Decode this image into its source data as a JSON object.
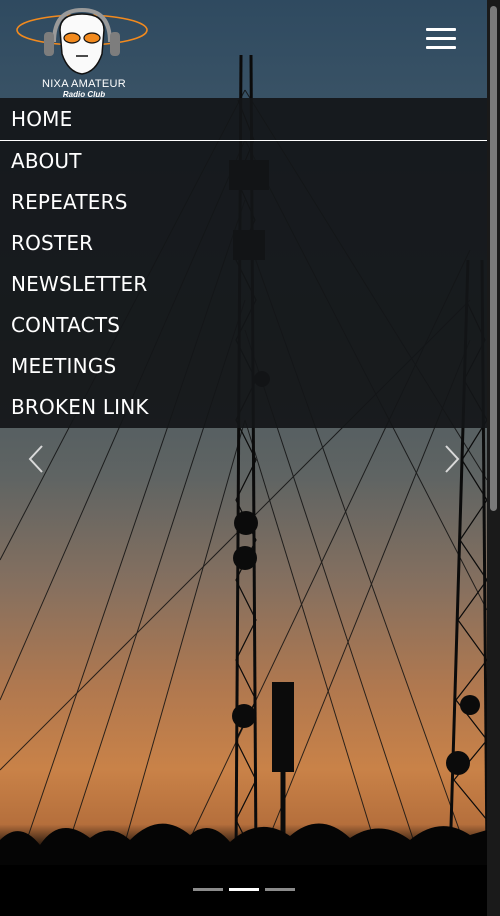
{
  "branding": {
    "logo_line1": "NIXA AMATEUR",
    "logo_line2": "Radio Club"
  },
  "header": {
    "menu_icon": "hamburger-menu-icon"
  },
  "nav": {
    "items": [
      {
        "label": "HOME",
        "active": true
      },
      {
        "label": "ABOUT"
      },
      {
        "label": "REPEATERS"
      },
      {
        "label": "ROSTER"
      },
      {
        "label": "NEWSLETTER"
      },
      {
        "label": "CONTACTS"
      },
      {
        "label": "MEETINGS"
      },
      {
        "label": "BROKEN LINK"
      }
    ]
  },
  "carousel": {
    "prev_icon": "chevron-left-icon",
    "next_icon": "chevron-right-icon",
    "slide_count": 3,
    "active_slide": 2
  },
  "colors": {
    "nav_background": "#141618",
    "logo_accent": "#f28a1e",
    "text": "#ffffff"
  }
}
